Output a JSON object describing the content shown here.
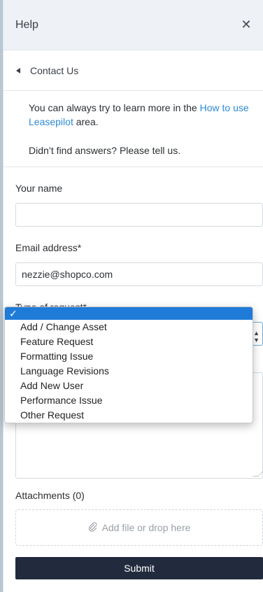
{
  "header": {
    "title": "Help",
    "close_icon": "close-icon"
  },
  "breadcrumb": {
    "label": "Contact Us"
  },
  "info": {
    "text_before_link": "You can always try to learn more in the ",
    "link_text": "How to use Leasepilot",
    "text_after_link": " area.",
    "second_line": "Didn’t find answers? Please tell us."
  },
  "form": {
    "name": {
      "label": "Your name",
      "value": ""
    },
    "email": {
      "label": "Email address*",
      "value": "nezzie@shopco.com"
    },
    "request_type": {
      "label": "Type of request*",
      "selected_mark": "✓",
      "options": [
        "Add / Change Asset",
        "Feature Request",
        "Formatting Issue",
        "Language Revisions",
        "Add New User",
        "Performance Issue",
        "Other Request"
      ]
    },
    "attachments": {
      "label": "Attachments (0)",
      "dropzone": "Add file or drop here"
    },
    "submit_label": "Submit"
  },
  "colors": {
    "accent": "#1f7bd8",
    "link": "#2f8bd1",
    "submit_bg": "#222b3d",
    "header_bg": "#eef1f5"
  }
}
